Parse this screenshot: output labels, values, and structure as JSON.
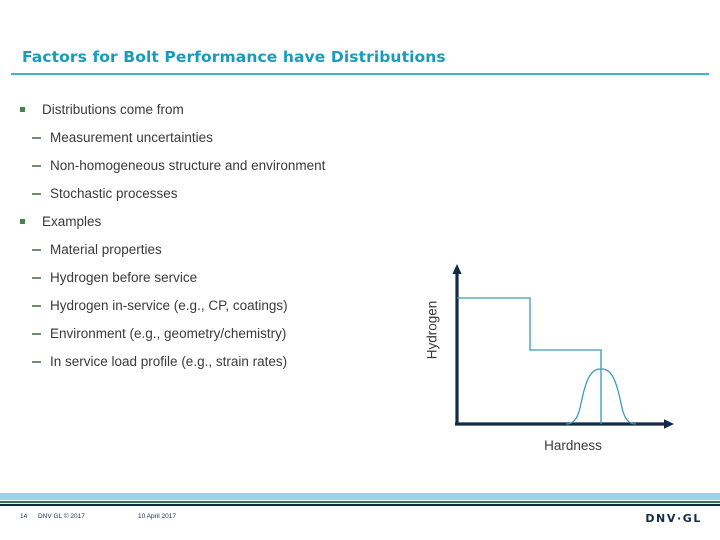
{
  "slide": {
    "title": "Factors for Bolt Performance have Distributions",
    "accent_color": "#1a9bbd",
    "rule_color": "#3fb4cc"
  },
  "content": {
    "groups": [
      {
        "heading": "Distributions come from",
        "items": [
          "Measurement uncertainties",
          "Non-homogeneous structure and environment",
          "Stochastic processes"
        ]
      },
      {
        "heading": "Examples",
        "items": [
          "Material properties",
          "Hydrogen before service",
          "Hydrogen in-service (e.g., CP, coatings)",
          "Environment (e.g., geometry/chemistry)",
          "In service load profile (e.g., strain rates)"
        ]
      }
    ]
  },
  "figure": {
    "ylabel": "Hydrogen",
    "xlabel": "Hardness",
    "axis_color": "#122b48",
    "curve_color": "#3a9bb5"
  },
  "chart_data": {
    "type": "line",
    "title": "",
    "xlabel": "Hardness",
    "ylabel": "Hydrogen",
    "xlim": [
      0,
      100
    ],
    "ylim": [
      0,
      100
    ],
    "grid": false,
    "legend": "none",
    "series": [
      {
        "name": "Hydrogen threshold step",
        "type": "step",
        "x": [
          0,
          34,
          34,
          67,
          67
        ],
        "y": [
          87,
          87,
          47,
          47,
          0
        ]
      },
      {
        "name": "Hardness distribution",
        "type": "bell",
        "mean": 67,
        "sigma": 6.5,
        "peak": 42,
        "x": [
          48,
          52,
          56,
          60,
          63,
          67,
          71,
          74,
          78,
          82,
          86
        ],
        "y": [
          1,
          3,
          9,
          24,
          37,
          42,
          38,
          26,
          10,
          3,
          1
        ]
      }
    ],
    "annotations": []
  },
  "footer": {
    "page_number": "14",
    "copyright": "DNV GL © 2017",
    "date": "10 April 2017",
    "logo": "DNV·GL",
    "band_colors": {
      "light_blue": "#99d3ea",
      "green": "#2b7a4b",
      "navy": "#122b48"
    }
  }
}
